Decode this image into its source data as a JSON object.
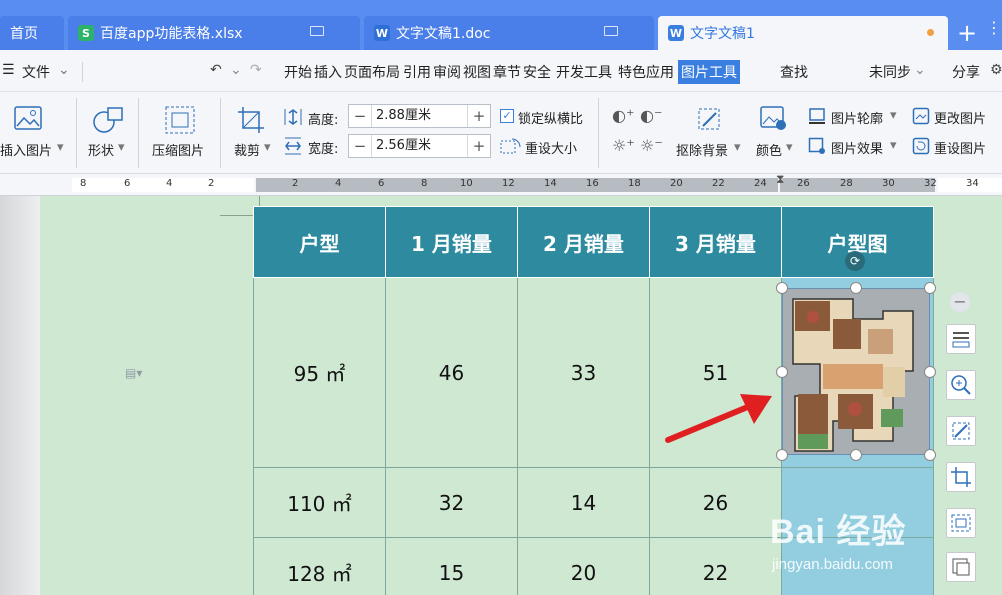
{
  "tabs": {
    "home": "首页",
    "xlsx": "百度app功能表格.xlsx",
    "doc": "文字文稿1.doc",
    "active": "文字文稿1",
    "plus": "+",
    "more": "⋮"
  },
  "menubar": {
    "file": "文件",
    "items": [
      "开始",
      "插入",
      "页面布局",
      "引用",
      "审阅",
      "视图",
      "章节",
      "安全",
      "开发工具",
      "特色应用"
    ],
    "active": "图片工具",
    "search": "查找",
    "sync": "未同步",
    "share": "分享"
  },
  "ribbon": {
    "insert_picture": "插入图片",
    "shape": "形状",
    "compress": "压缩图片",
    "crop": "裁剪",
    "height_label": "高度:",
    "height_value": "2.88厘米",
    "width_label": "宽度:",
    "width_value": "2.56厘米",
    "lock_ratio": "锁定纵横比",
    "reset_size": "重设大小",
    "remove_bg": "抠除背景",
    "color": "颜色",
    "outline": "图片轮廓",
    "effects": "图片效果",
    "change_picture": "更改图片",
    "reset_picture": "重设图片"
  },
  "ruler": {
    "left": [
      "8",
      "6",
      "4",
      "2"
    ],
    "right": [
      "2",
      "4",
      "6",
      "8",
      "10",
      "12",
      "14",
      "16",
      "18",
      "20",
      "22",
      "24",
      "26",
      "28",
      "30",
      "32",
      "34"
    ]
  },
  "table": {
    "headers": [
      "户型",
      "1 月销量",
      "2 月销量",
      "3 月销量",
      "户型图"
    ],
    "rows": [
      [
        "95 ㎡",
        "46",
        "33",
        "51",
        ""
      ],
      [
        "110 ㎡",
        "32",
        "14",
        "26",
        ""
      ],
      [
        "128 ㎡",
        "15",
        "20",
        "22",
        ""
      ]
    ]
  },
  "watermark": {
    "logo": "Bai 经验",
    "url": "jingyan.baidu.com"
  },
  "colors": {
    "header_bg": "#2e8a9f",
    "cell_bg": "#cfe8d2",
    "picture_col_bg": "#92cde0",
    "accent": "#3a7fe0",
    "arrow": "#e02020"
  }
}
